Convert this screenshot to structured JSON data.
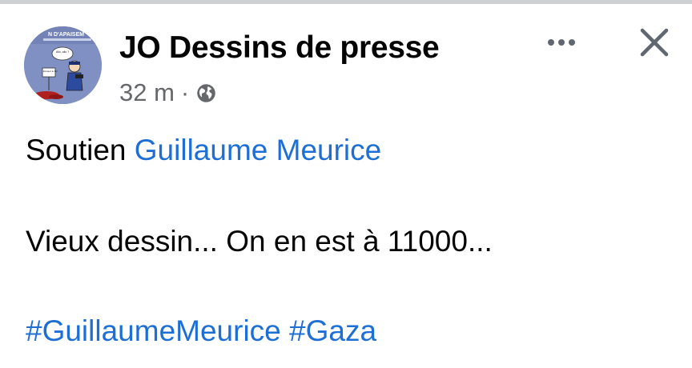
{
  "header": {
    "page_name": "JO Dessins de presse",
    "timestamp": "32 m",
    "separator": "·",
    "audience_icon": "globe-icon",
    "avatar_text": "N D'APAISEM",
    "avatar_bubble": "Allo, allo ?",
    "avatar_sign": "Écrasez le tirit"
  },
  "actions": {
    "more_icon": "more-horizontal-icon",
    "close_icon": "close-icon"
  },
  "post": {
    "line1_prefix": "Soutien ",
    "line1_mention": "Guillaume Meurice",
    "line2": "Vieux dessin... On en est à 11000...",
    "hashtag1": "#GuillaumeMeurice",
    "hashtag_separator": " ",
    "hashtag2": "#Gaza"
  },
  "colors": {
    "link": "#1d6fd6",
    "secondary_text": "#65676b",
    "primary_text": "#050505"
  }
}
